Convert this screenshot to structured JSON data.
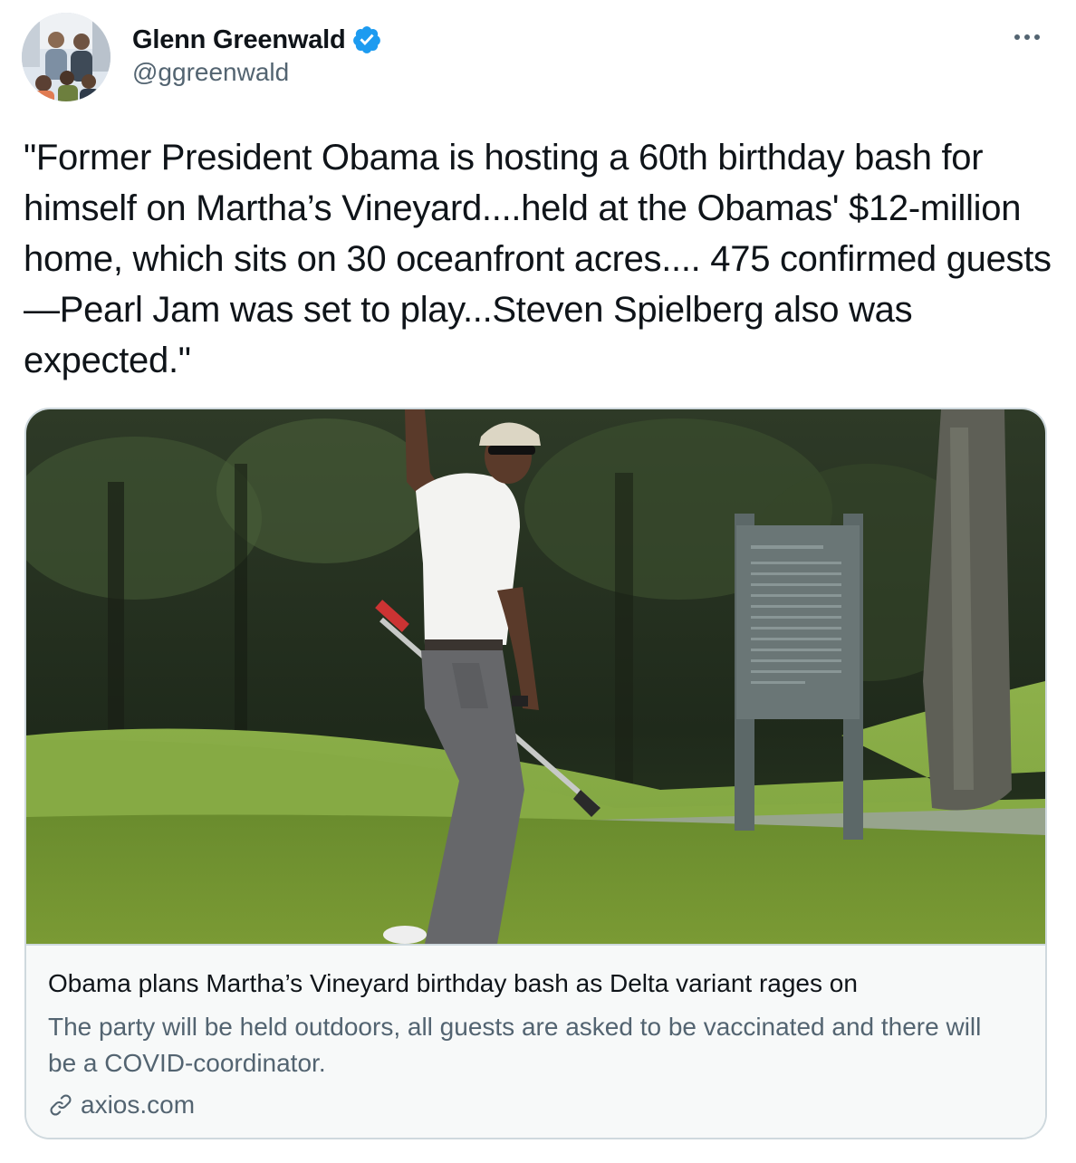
{
  "author": {
    "display_name": "Glenn Greenwald",
    "handle": "@ggreenwald",
    "verified": true,
    "avatar_icon": "family-photo-avatar"
  },
  "menu": {
    "more_icon": "more-horizontal-icon"
  },
  "tweet": {
    "text": "\"Former President Obama is hosting a 60th birthday bash for himself on Martha’s Vineyard....held at the Obamas' $12-million home, which sits on 30 oceanfront acres.... 475 confirmed guests —Pearl Jam was set to play...Steven Spielberg also was expected.\""
  },
  "card": {
    "image_icon": "golf-course-photo",
    "title": "Obama plans Martha’s Vineyard birthday bash as Delta variant rages on",
    "description": "The party will be held outdoors, all guests are asked to be vaccinated and there will be a COVID-coordinator.",
    "domain": "axios.com",
    "domain_icon": "link-icon"
  },
  "colors": {
    "text_primary": "#0f1419",
    "text_secondary": "#536471",
    "verified_blue": "#1d9bf0",
    "card_border": "#cfd9de",
    "card_meta_bg": "#f7f9f9"
  }
}
